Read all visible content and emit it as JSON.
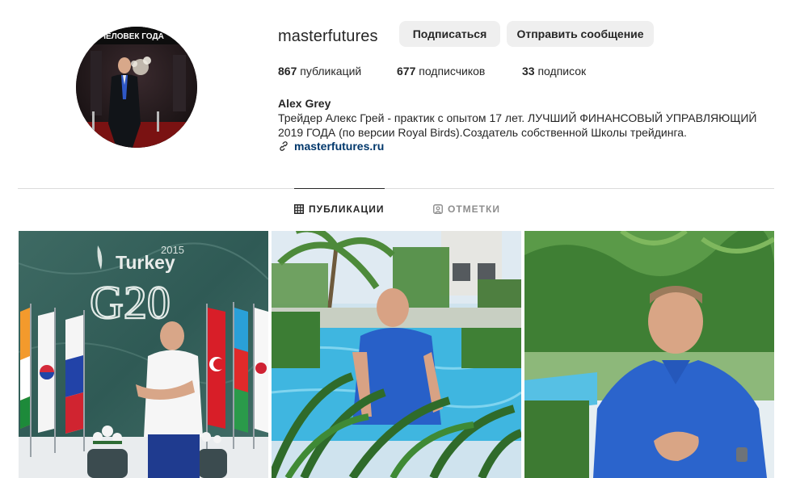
{
  "profile": {
    "username": "masterfutures",
    "avatar_caption": "ЧЕЛОВЕК ГОДА",
    "follow_label": "Подписаться",
    "message_label": "Отправить сообщение",
    "stats": {
      "posts_count": "867",
      "posts_label": " публикаций",
      "followers_count": "677",
      "followers_label": " подписчиков",
      "following_count": "33",
      "following_label": " подписок"
    },
    "full_name": "Alex Grey",
    "bio": "Трейдер Алекс Грей - практик с опытом 17 лет. ЛУЧШИЙ ФИНАНСОВЫЙ УПРАВЛЯЮЩИЙ 2019 ГОДА (по версии Royal Birds).Создатель собственной Школы трейдинга.",
    "website": "masterfutures.ru"
  },
  "tabs": {
    "posts_label": "ПУБЛИКАЦИИ",
    "tagged_label": "ОТМЕТКИ"
  },
  "posts": {
    "post1_sign_year": "2015",
    "post1_sign_country": "Turkey",
    "post1_sign_event": "G20"
  },
  "colors": {
    "button_bg": "#efefef",
    "link": "#00376b",
    "divider": "#dbdbdb",
    "muted": "#8e8e8e"
  },
  "icons": {
    "link": "link-icon",
    "posts_tab": "grid-icon",
    "tagged_tab": "tag-user-icon"
  }
}
